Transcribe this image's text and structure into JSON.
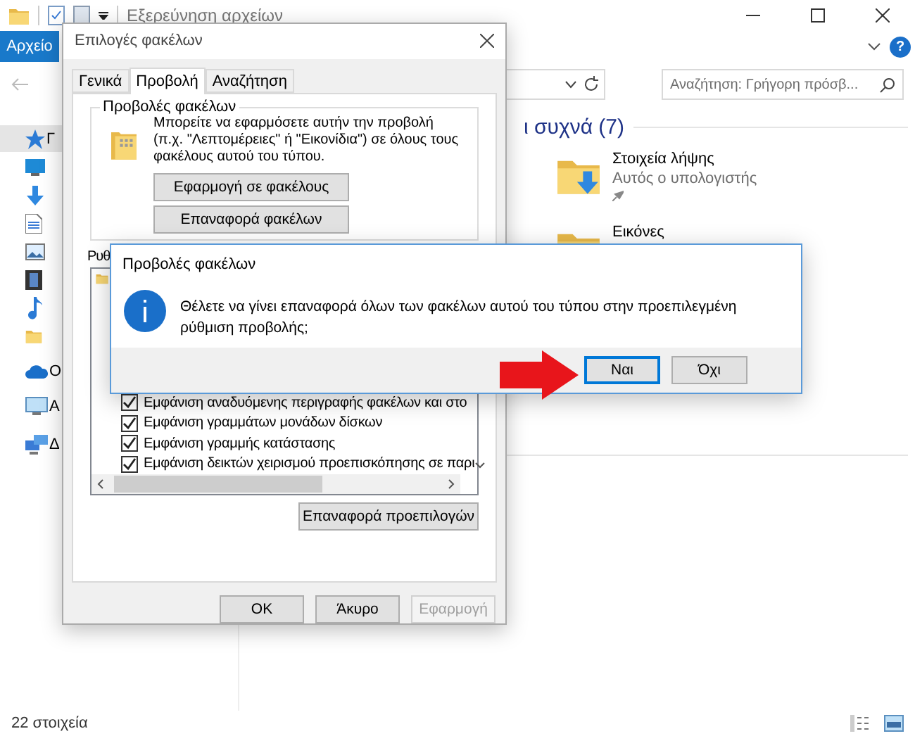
{
  "explorer": {
    "title": "Εξερεύνηση αρχείων",
    "file_tab": "Αρχείο",
    "help": "?",
    "search": {
      "placeholder": "Αναζήτηση: Γρήγορη πρόσβ..."
    },
    "navigation": [
      {
        "kind": "quick-access",
        "label": "Γ",
        "selected": true
      },
      {
        "kind": "desktop",
        "selected": false
      },
      {
        "kind": "downloads",
        "selected": false
      },
      {
        "kind": "documents",
        "selected": false
      },
      {
        "kind": "pictures",
        "selected": false
      },
      {
        "kind": "videos",
        "selected": false
      },
      {
        "kind": "music",
        "selected": false
      },
      {
        "kind": "folder",
        "selected": false
      },
      {
        "kind": "onedrive",
        "label": "Ο",
        "selected": false
      },
      {
        "kind": "this-pc",
        "label": "Α",
        "selected": false
      },
      {
        "kind": "network",
        "label": "Δ",
        "selected": false
      }
    ],
    "section_heading": "ι συχνά (7)",
    "folders": [
      {
        "kind": "downloads",
        "name": "Στοιχεία λήψης",
        "location": "Αυτός ο υπολογιστής",
        "pinned": true
      },
      {
        "kind": "pictures",
        "name": "Εικόνες"
      }
    ],
    "status_bar": {
      "count": "22 στοιχεία"
    }
  },
  "folder_options": {
    "title": "Επιλογές φακέλων",
    "tabs": [
      {
        "label": "Γενικά",
        "selected": false
      },
      {
        "label": "Προβολή",
        "selected": true
      },
      {
        "label": "Αναζήτηση",
        "selected": false
      }
    ],
    "group": {
      "title": "Προβολές φακέλων",
      "description": "Μπορείτε να εφαρμόσετε αυτήν την προβολή (π.χ. \"Λεπτομέρειες\" ή \"Εικονίδια\") σε όλους τους φακέλους αυτού του τύπου.",
      "buttons": [
        "Εφαρμογή σε φακέλους",
        "Επαναφορά φακέλων"
      ]
    },
    "settings_label": "Ρυθ",
    "settings": [
      {
        "label": "Εμφάνιση αναδυόμενης περιγραφής φακέλων και στο",
        "checked": true
      },
      {
        "label": "Εμφάνιση γραμμάτων μονάδων δίσκων",
        "checked": true
      },
      {
        "label": "Εμφάνιση γραμμής κατάστασης",
        "checked": true
      },
      {
        "label": "Εμφάνιση δεικτών χειρισμού προεπισκόπησης σε παρι",
        "checked": true
      }
    ],
    "restore_button": "Επαναφορά προεπιλογών",
    "buttons": [
      {
        "label": "OK",
        "disabled": false
      },
      {
        "label": "Άκυρο",
        "disabled": false
      },
      {
        "label": "Εφαρμογή",
        "disabled": true
      }
    ]
  },
  "message_box": {
    "title": "Προβολές φακέλων",
    "message": "Θέλετε να γίνει επαναφορά όλων των φακέλων αυτού του τύπου στην προεπιλεγμένη ρύθμιση προβολής;",
    "buttons": [
      {
        "label": "Ναι",
        "focused": true
      },
      {
        "label": "Όχι",
        "focused": false
      }
    ]
  }
}
